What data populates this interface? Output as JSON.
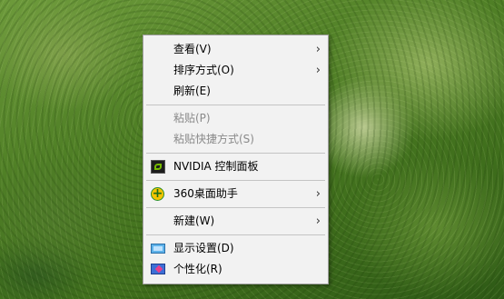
{
  "context_menu": {
    "items": [
      {
        "label": "查看(V)",
        "has_submenu": true,
        "enabled": true
      },
      {
        "label": "排序方式(O)",
        "has_submenu": true,
        "enabled": true
      },
      {
        "label": "刷新(E)",
        "has_submenu": false,
        "enabled": true
      },
      {
        "label": "粘贴(P)",
        "has_submenu": false,
        "enabled": false
      },
      {
        "label": "粘贴快捷方式(S)",
        "has_submenu": false,
        "enabled": false
      },
      {
        "label": "NVIDIA 控制面板",
        "has_submenu": false,
        "enabled": true,
        "icon": "nvidia-icon"
      },
      {
        "label": "360桌面助手",
        "has_submenu": true,
        "enabled": true,
        "icon": "360-icon"
      },
      {
        "label": "新建(W)",
        "has_submenu": true,
        "enabled": true
      },
      {
        "label": "显示设置(D)",
        "has_submenu": false,
        "enabled": true,
        "icon": "display-settings-icon"
      },
      {
        "label": "个性化(R)",
        "has_submenu": false,
        "enabled": true,
        "icon": "personalize-icon"
      }
    ],
    "submenu_arrow": "›"
  },
  "colors": {
    "menu_bg": "#f2f2f2",
    "disabled_text": "#8a8a8a",
    "separator": "#c4c4c4"
  }
}
